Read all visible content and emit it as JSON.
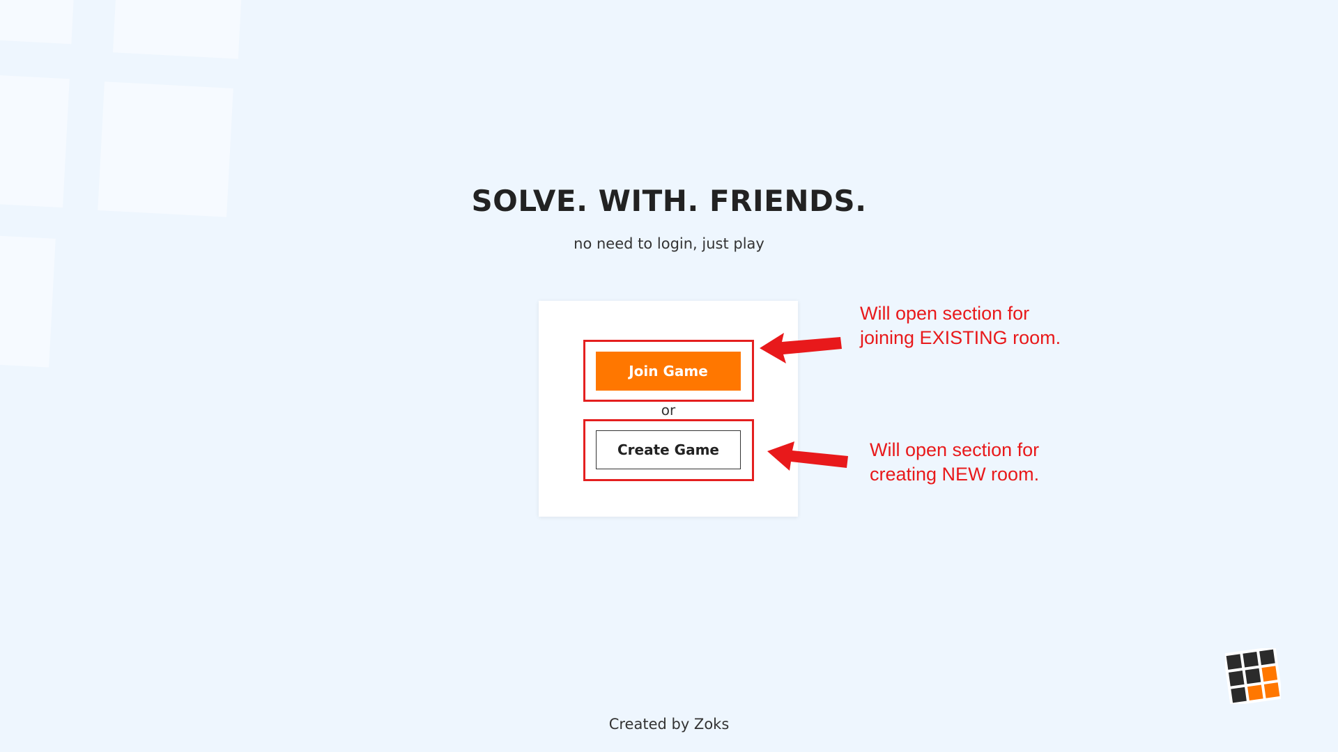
{
  "hero": {
    "title": "SOLVE. WITH. FRIENDS.",
    "subtitle": "no need to login, just play"
  },
  "actions": {
    "join_label": "Join Game",
    "separator": "or",
    "create_label": "Create Game"
  },
  "annotations": {
    "join_line1": "Will open section for",
    "join_line2": "joining EXISTING room.",
    "create_line1": "Will open section for",
    "create_line2": "creating NEW room."
  },
  "footer": {
    "credit": "Created by Zoks"
  },
  "colors": {
    "accent": "#ff7700",
    "annotation": "#e8191b",
    "background": "#eef6fe"
  },
  "icons": {
    "logo": "grid-cube-logo-icon",
    "arrows": "red-arrow-icon"
  }
}
